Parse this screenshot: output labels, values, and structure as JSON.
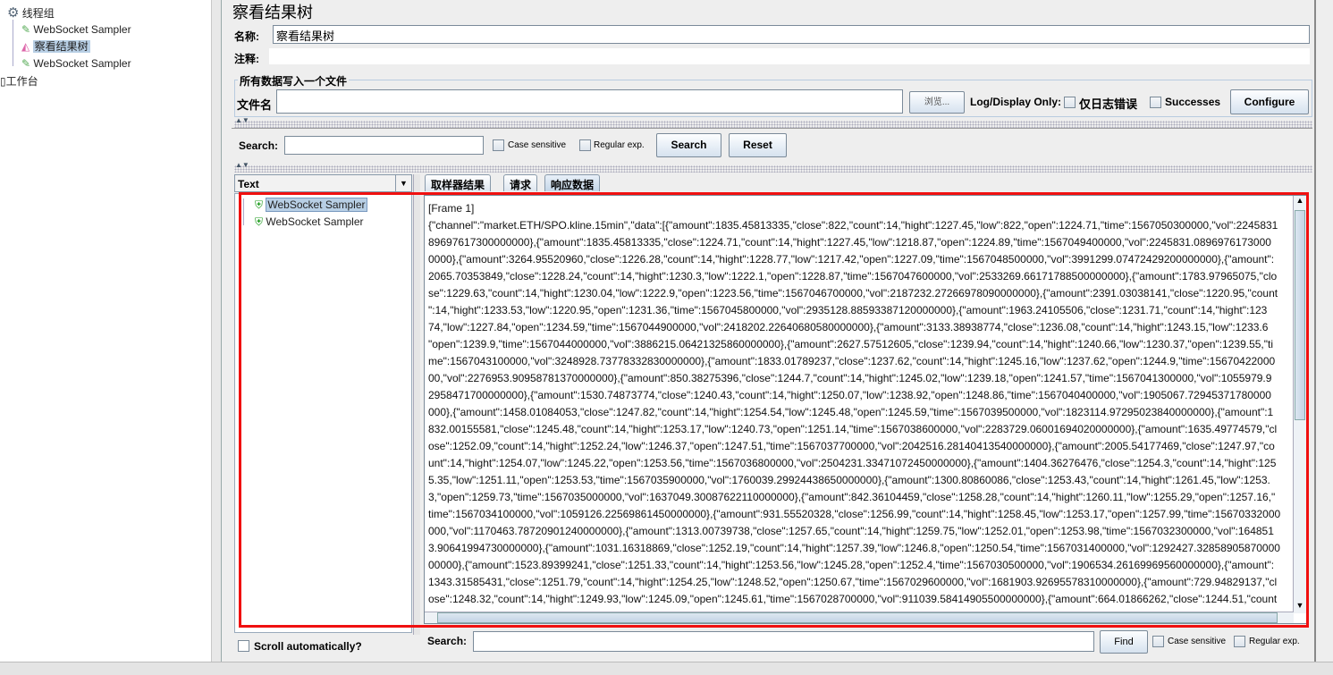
{
  "tree": {
    "items": [
      {
        "label": "线程组",
        "icon": "gear-icon"
      },
      {
        "label": "WebSocket Sampler",
        "icon": "pipette-icon"
      },
      {
        "label": "察看结果树",
        "icon": "graph-icon",
        "selected": true
      },
      {
        "label": "WebSocket Sampler",
        "icon": "pipette-icon"
      },
      {
        "label": "工作台",
        "icon": "workbench-icon"
      }
    ]
  },
  "panel": {
    "title": "察看结果树",
    "name_label": "名称:",
    "name_value": "察看结果树",
    "comment_label": "注释:",
    "comment_value": "",
    "file_group": "所有数据写入一个文件",
    "file_label": "文件名",
    "file_value": "",
    "browse": "浏览...",
    "log_display": "Log/Display Only:",
    "errors_only": "仅日志错误",
    "successes": "Successes",
    "configure": "Configure"
  },
  "search": {
    "label": "Search:",
    "value": "",
    "case": "Case sensitive",
    "regex": "Regular exp.",
    "search_btn": "Search",
    "reset_btn": "Reset"
  },
  "results": {
    "renderer": "Text",
    "samples": [
      "WebSocket Sampler",
      "WebSocket Sampler"
    ],
    "scroll_auto": "Scroll automatically?"
  },
  "tabs": [
    "取样器结果",
    "请求",
    "响应数据"
  ],
  "selected_tab": "响应数据",
  "response_lines": [
    "[Frame 1]",
    "{\"channel\":\"market.ETH/SPO.kline.15min\",\"data\":[{\"amount\":1835.45813335,\"close\":822,\"count\":14,\"hight\":1227.45,\"low\":822,\"open\":1224.71,\"time\":1567050300000,\"vol\":2245831",
    "89697617300000000},{\"amount\":1835.45813335,\"close\":1224.71,\"count\":14,\"hight\":1227.45,\"low\":1218.87,\"open\":1224.89,\"time\":1567049400000,\"vol\":2245831.0896976173000",
    "0000},{\"amount\":3264.95520960,\"close\":1226.28,\"count\":14,\"hight\":1228.77,\"low\":1217.42,\"open\":1227.09,\"time\":1567048500000,\"vol\":3991299.07472429200000000},{\"amount\":",
    "2065.70353849,\"close\":1228.24,\"count\":14,\"hight\":1230.3,\"low\":1222.1,\"open\":1228.87,\"time\":1567047600000,\"vol\":2533269.66171788500000000},{\"amount\":1783.97965075,\"clo",
    "se\":1229.63,\"count\":14,\"hight\":1230.04,\"low\":1222.9,\"open\":1223.56,\"time\":1567046700000,\"vol\":2187232.27266978090000000},{\"amount\":2391.03038141,\"close\":1220.95,\"count",
    "\":14,\"hight\":1233.53,\"low\":1220.95,\"open\":1231.36,\"time\":1567045800000,\"vol\":2935128.88593387120000000},{\"amount\":1963.24105506,\"close\":1231.71,\"count\":14,\"hight\":123",
    "74,\"low\":1227.84,\"open\":1234.59,\"time\":1567044900000,\"vol\":2418202.22640680580000000},{\"amount\":3133.38938774,\"close\":1236.08,\"count\":14,\"hight\":1243.15,\"low\":1233.6",
    "\"open\":1239.9,\"time\":1567044000000,\"vol\":3886215.06421325860000000},{\"amount\":2627.57512605,\"close\":1239.94,\"count\":14,\"hight\":1240.66,\"low\":1230.37,\"open\":1239.55,\"ti",
    "me\":1567043100000,\"vol\":3248928.73778332830000000},{\"amount\":1833.01789237,\"close\":1237.62,\"count\":14,\"hight\":1245.16,\"low\":1237.62,\"open\":1244.9,\"time\":15670422000",
    "00,\"vol\":2276953.90958781370000000},{\"amount\":850.38275396,\"close\":1244.7,\"count\":14,\"hight\":1245.02,\"low\":1239.18,\"open\":1241.57,\"time\":1567041300000,\"vol\":1055979.9",
    "2958471700000000},{\"amount\":1530.74873774,\"close\":1240.43,\"count\":14,\"hight\":1250.07,\"low\":1238.92,\"open\":1248.86,\"time\":1567040400000,\"vol\":1905067.72945371780000",
    "000},{\"amount\":1458.01084053,\"close\":1247.82,\"count\":14,\"hight\":1254.54,\"low\":1245.48,\"open\":1245.59,\"time\":1567039500000,\"vol\":1823114.97295023840000000},{\"amount\":1",
    "832.00155581,\"close\":1245.48,\"count\":14,\"hight\":1253.17,\"low\":1240.73,\"open\":1251.14,\"time\":1567038600000,\"vol\":2283729.06001694020000000},{\"amount\":1635.49774579,\"cl",
    "ose\":1252.09,\"count\":14,\"hight\":1252.24,\"low\":1246.37,\"open\":1247.51,\"time\":1567037700000,\"vol\":2042516.28140413540000000},{\"amount\":2005.54177469,\"close\":1247.97,\"co",
    "unt\":14,\"hight\":1254.07,\"low\":1245.22,\"open\":1253.56,\"time\":1567036800000,\"vol\":2504231.33471072450000000},{\"amount\":1404.36276476,\"close\":1254.3,\"count\":14,\"hight\":125",
    "5.35,\"low\":1251.11,\"open\":1253.53,\"time\":1567035900000,\"vol\":1760039.29924438650000000},{\"amount\":1300.80860086,\"close\":1253.43,\"count\":14,\"hight\":1261.45,\"low\":1253.",
    "3,\"open\":1259.73,\"time\":1567035000000,\"vol\":1637049.30087622110000000},{\"amount\":842.36104459,\"close\":1258.28,\"count\":14,\"hight\":1260.11,\"low\":1255.29,\"open\":1257.16,\"",
    "time\":1567034100000,\"vol\":1059126.22569861450000000},{\"amount\":931.55520328,\"close\":1256.99,\"count\":14,\"hight\":1258.45,\"low\":1253.17,\"open\":1257.99,\"time\":15670332000",
    "000,\"vol\":1170463.78720901240000000},{\"amount\":1313.00739738,\"close\":1257.65,\"count\":14,\"hight\":1259.75,\"low\":1252.01,\"open\":1253.98,\"time\":1567032300000,\"vol\":164851",
    "3.90641994730000000},{\"amount\":1031.16318869,\"close\":1252.19,\"count\":14,\"hight\":1257.39,\"low\":1246.8,\"open\":1250.54,\"time\":1567031400000,\"vol\":1292427.32858905870000",
    "00000},{\"amount\":1523.89399241,\"close\":1251.33,\"count\":14,\"hight\":1253.56,\"low\":1245.28,\"open\":1252.4,\"time\":1567030500000,\"vol\":1906534.26169969560000000},{\"amount\":",
    "1343.31585431,\"close\":1251.79,\"count\":14,\"hight\":1254.25,\"low\":1248.52,\"open\":1250.67,\"time\":1567029600000,\"vol\":1681903.92695578310000000},{\"amount\":729.94829137,\"cl",
    "ose\":1248.32,\"count\":14,\"hight\":1249.93,\"low\":1245.09,\"open\":1245.61,\"time\":1567028700000,\"vol\":911039.58414905500000000},{\"amount\":664.01866262,\"close\":1244.51,\"count",
    "\":14,\"hight\":1249.21,\"low\":1242.89,\"open\":1244.99,\"time\":1567027800000,\"vol\":827300.07405314260000000},{\"amount\":517.63910411,\"close\":1245.38,\"count\":14,\"hight\":1247.0",
    "\"low\":1241.07,\"open\":1241.53,\"time\":1567026900000,\"vol\":644421.82885714850000000},{\"amount\":537.68724251,\"close\":1241.65,\"count\":14,\"hight\":1242.6,\"low\":1234.37,\"open"
  ],
  "find": {
    "label": "Search:",
    "value": "",
    "find_btn": "Find",
    "case": "Case sensitive",
    "regex": "Regular exp."
  },
  "colors": {
    "highlight_box": "#f01010",
    "selection": "#b8cfe5"
  }
}
